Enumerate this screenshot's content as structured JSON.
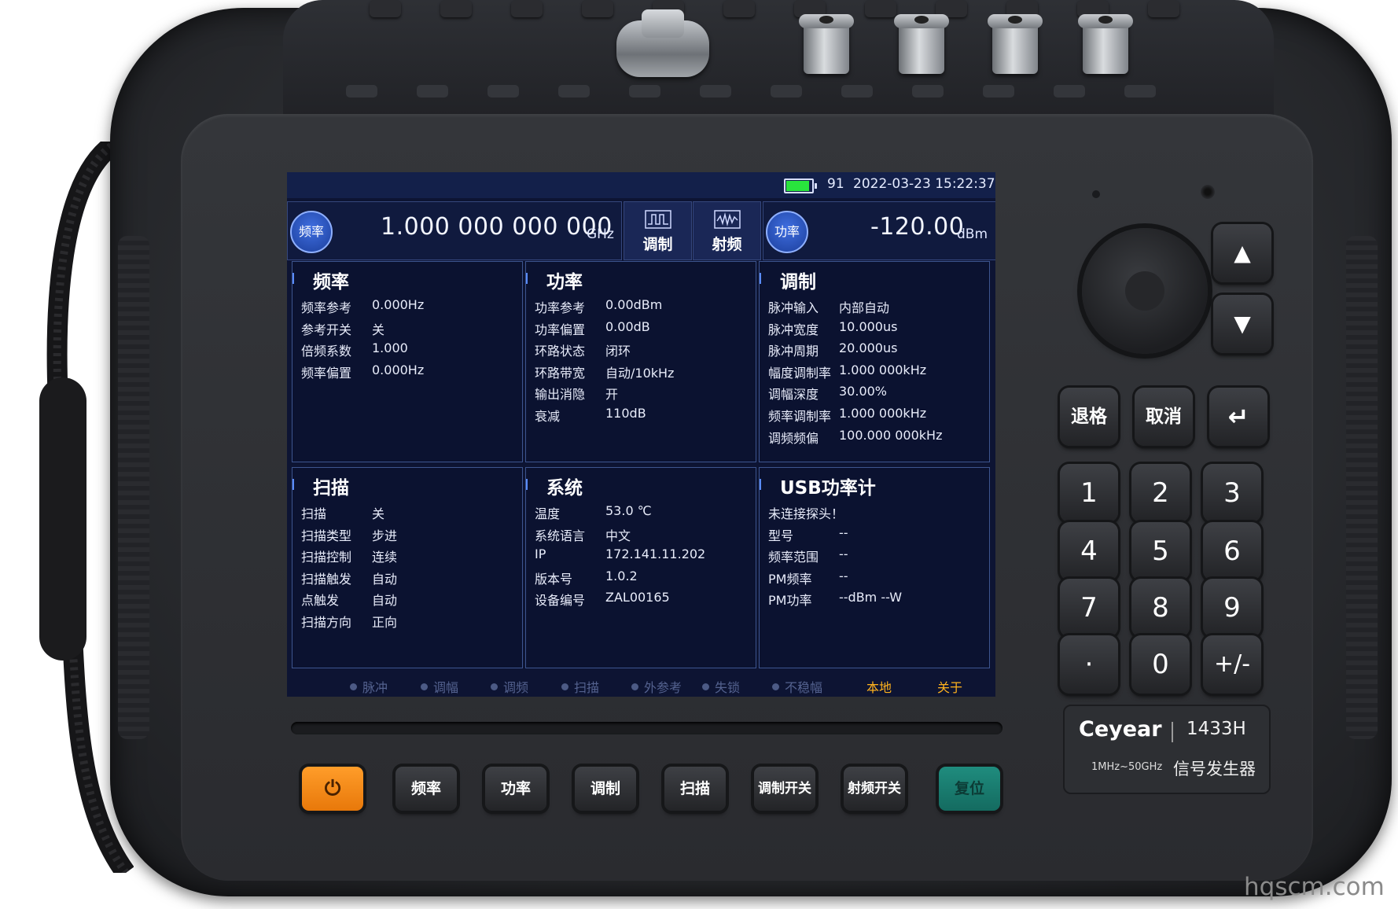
{
  "status": {
    "battery_level": "91",
    "battery_fill_fraction": 0.91,
    "datetime": "2022-03-23 15:22:37",
    "battery_color": "#29e33d"
  },
  "frequency": {
    "label": "频率",
    "value": "1.000 000 000 000",
    "unit": "GHz"
  },
  "tabs": {
    "modulation": "调制",
    "rf": "射频"
  },
  "power": {
    "label": "功率",
    "value": "-120.00",
    "unit": "dBm"
  },
  "panels": {
    "freq": {
      "title": "频率",
      "rows": [
        {
          "k": "频率参考",
          "v": "0.000Hz"
        },
        {
          "k": "参考开关",
          "v": "关"
        },
        {
          "k": "倍频系数",
          "v": "1.000"
        },
        {
          "k": "频率偏置",
          "v": "0.000Hz"
        }
      ]
    },
    "power": {
      "title": "功率",
      "rows": [
        {
          "k": "功率参考",
          "v": "0.00dBm"
        },
        {
          "k": "功率偏置",
          "v": "0.00dB"
        },
        {
          "k": "环路状态",
          "v": "闭环"
        },
        {
          "k": "环路带宽",
          "v": "自动/10kHz"
        },
        {
          "k": "输出消隐",
          "v": "开"
        },
        {
          "k": "衰减",
          "v": "110dB"
        }
      ]
    },
    "mod": {
      "title": "调制",
      "rows": [
        {
          "k": "脉冲输入",
          "v": "内部自动"
        },
        {
          "k": "脉冲宽度",
          "v": "10.000us"
        },
        {
          "k": "脉冲周期",
          "v": "20.000us"
        },
        {
          "k": "幅度调制率",
          "v": "1.000 000kHz"
        },
        {
          "k": "调幅深度",
          "v": "30.00%"
        },
        {
          "k": "频率调制率",
          "v": "1.000 000kHz"
        },
        {
          "k": "调频频偏",
          "v": "100.000 000kHz"
        }
      ]
    },
    "sweep": {
      "title": "扫描",
      "rows": [
        {
          "k": "扫描",
          "v": "关"
        },
        {
          "k": "扫描类型",
          "v": "步进"
        },
        {
          "k": "扫描控制",
          "v": "连续"
        },
        {
          "k": "扫描触发",
          "v": "自动"
        },
        {
          "k": "点触发",
          "v": "自动"
        },
        {
          "k": "扫描方向",
          "v": "正向"
        }
      ]
    },
    "system": {
      "title": "系统",
      "rows": [
        {
          "k": "温度",
          "v": "53.0 ℃"
        },
        {
          "k": "系统语言",
          "v": "中文"
        },
        {
          "k": "IP",
          "v": "172.141.11.202"
        },
        {
          "k": "版本号",
          "v": "1.0.2"
        },
        {
          "k": "设备编号",
          "v": "ZAL00165"
        }
      ]
    },
    "usb": {
      "title": "USB功率计",
      "rows": [
        {
          "k": "未连接探头！",
          "v": ""
        },
        {
          "k": "型号",
          "v": "--"
        },
        {
          "k": "频率范围",
          "v": "--"
        },
        {
          "k": "PM频率",
          "v": "--"
        },
        {
          "k": "PM功率",
          "v": "--dBm --W"
        }
      ]
    }
  },
  "indicators": [
    "脉冲",
    "调幅",
    "调频",
    "扫描",
    "外参考",
    "失锁",
    "不稳幅"
  ],
  "soft_buttons": {
    "local": "本地",
    "about": "关于"
  },
  "keypad": {
    "up": "▲",
    "down": "▼",
    "backspace": "退格",
    "cancel": "取消",
    "enter": "↵",
    "digits": [
      "1",
      "2",
      "3",
      "4",
      "5",
      "6",
      "7",
      "8",
      "9",
      "·",
      "0",
      "+/-"
    ]
  },
  "function_keys": {
    "power": "⏻",
    "freq": "频率",
    "power_level": "功率",
    "mod": "调制",
    "sweep": "扫描",
    "mod_switch": "调制开关",
    "rf_switch": "射频开关",
    "reset": "复位"
  },
  "brand": {
    "logo": "Ceyear",
    "model": "1433H",
    "range": "1MHz~50GHz",
    "name": "信号发生器"
  },
  "watermark": "hqscm.com",
  "colors": {
    "orange_indicator": "#ffb21e",
    "screen_bg": "#0d1433",
    "power_key": "#f28a16",
    "reset_key": "#1a7f72"
  }
}
